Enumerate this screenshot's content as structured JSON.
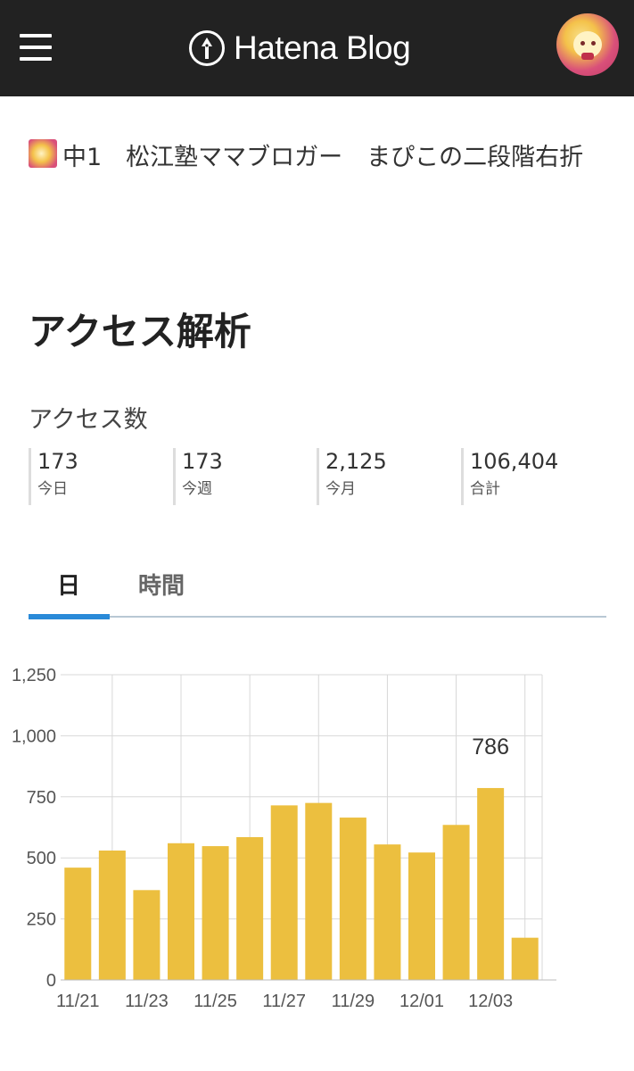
{
  "header": {
    "logo_text": "Hatena Blog",
    "menu_icon": "hamburger-menu-icon",
    "logo_icon": "hatena-pen-icon"
  },
  "blog": {
    "title": "中1　松江塾ママブロガー　まぴこの二段階右折"
  },
  "page": {
    "title": "アクセス解析"
  },
  "access": {
    "label": "アクセス数",
    "stats": [
      {
        "value": "173",
        "label": "今日"
      },
      {
        "value": "173",
        "label": "今週"
      },
      {
        "value": "2,125",
        "label": "今月"
      },
      {
        "value": "106,404",
        "label": "合計"
      }
    ]
  },
  "tabs": [
    {
      "label": "日",
      "active": true
    },
    {
      "label": "時間",
      "active": false
    }
  ],
  "colors": {
    "header_bg": "#222222",
    "bar": "#ecbf3f",
    "tab_active": "#2a8ad8"
  },
  "chart_data": {
    "type": "bar",
    "categories": [
      "11/21",
      "11/22",
      "11/23",
      "11/24",
      "11/25",
      "11/26",
      "11/27",
      "11/28",
      "11/29",
      "11/30",
      "12/01",
      "12/02",
      "12/03",
      "12/04"
    ],
    "x_tick_labels": [
      "11/21",
      "11/23",
      "11/25",
      "11/27",
      "11/29",
      "12/01",
      "12/03"
    ],
    "values": [
      460,
      530,
      368,
      560,
      548,
      585,
      715,
      725,
      665,
      555,
      522,
      635,
      786,
      173
    ],
    "y_ticks": [
      "1,250",
      "1,000",
      "750",
      "500",
      "250",
      "0"
    ],
    "ylim": [
      0,
      1250
    ],
    "highlight_label": "786",
    "grid": true
  }
}
